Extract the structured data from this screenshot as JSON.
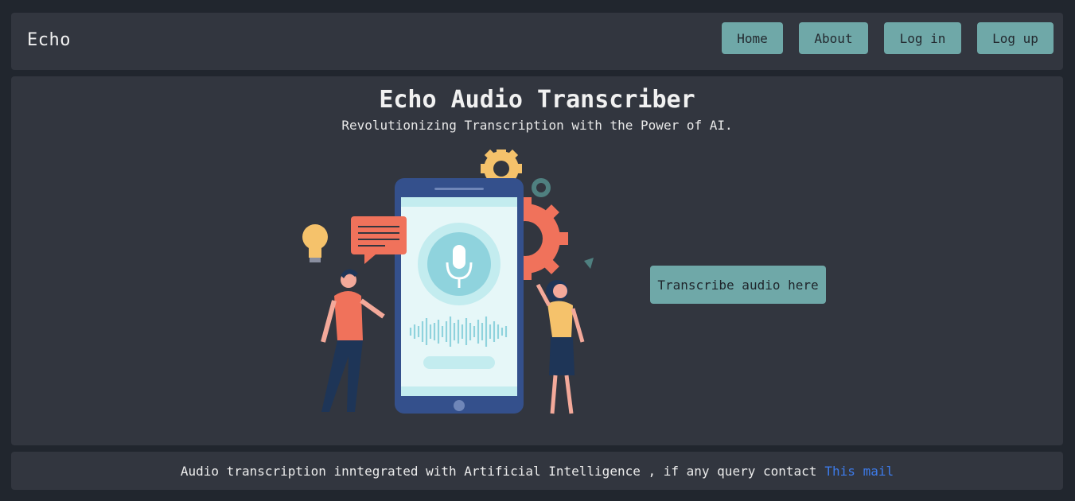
{
  "nav": {
    "brand": "Echo",
    "items": [
      {
        "label": "Home"
      },
      {
        "label": "About"
      },
      {
        "label": "Log in"
      },
      {
        "label": "Log up"
      }
    ]
  },
  "hero": {
    "title": "Echo Audio Transcriber",
    "subtitle": "Revolutionizing Transcription with the Power of AI.",
    "cta_label": "Transcribe audio here"
  },
  "footer": {
    "text": "Audio transcription inntegrated with Artificial Intelligence , if any query contact",
    "link_label": "This mail"
  },
  "colors": {
    "page_bg": "#21262e",
    "panel_bg": "#32363f",
    "accent": "#6fa8a8",
    "link": "#3d7bea"
  }
}
